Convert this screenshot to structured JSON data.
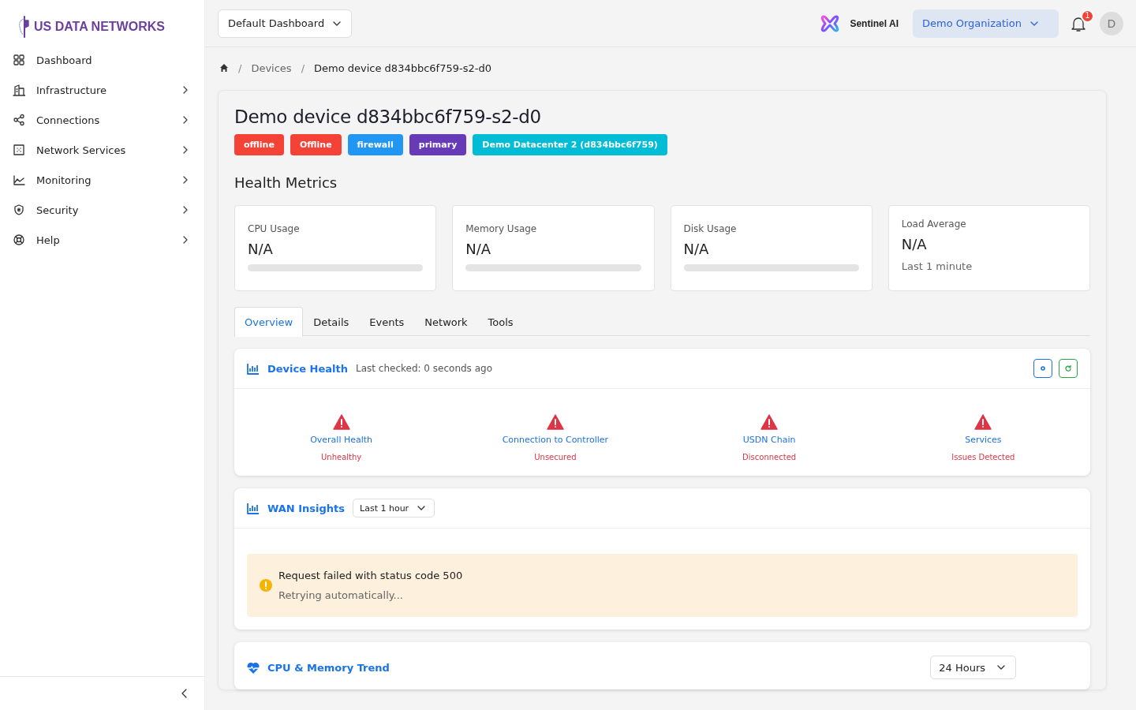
{
  "sidebar": {
    "logo": "US DATA NETWORKS",
    "items": [
      {
        "label": "Dashboard",
        "has_submenu": false
      },
      {
        "label": "Infrastructure",
        "has_submenu": true
      },
      {
        "label": "Connections",
        "has_submenu": true
      },
      {
        "label": "Network Services",
        "has_submenu": true
      },
      {
        "label": "Monitoring",
        "has_submenu": true
      },
      {
        "label": "Security",
        "has_submenu": true
      },
      {
        "label": "Help",
        "has_submenu": true
      }
    ]
  },
  "topbar": {
    "dashboard_select": "Default Dashboard",
    "assistant": "Sentinel AI",
    "organization": "Demo Organization",
    "notifications": "1",
    "avatar": "D"
  },
  "breadcrumb": [
    {
      "separator": "/",
      "label": "Devices"
    },
    {
      "separator": "/",
      "label": "Demo device d834bbc6f759-s2-d0"
    }
  ],
  "device": {
    "title": "Demo device d834bbc6f759-s2-d0",
    "badges": [
      {
        "label": "offline",
        "color": "#f44336"
      },
      {
        "label": "Offline",
        "color": "#f44336"
      },
      {
        "label": "firewall",
        "color": "#2196f3"
      },
      {
        "label": "primary",
        "color": "#673ab7"
      },
      {
        "label": "Demo Datacenter 2 (d834bbc6f759)",
        "color": "#00bcd4"
      }
    ]
  },
  "health_metrics": {
    "title": "Health Metrics",
    "cards": [
      {
        "kind": "bar",
        "label": "CPU Usage",
        "value": "N/A",
        "level": 0
      },
      {
        "kind": "bar",
        "label": "Memory Usage",
        "value": "N/A",
        "level": 0
      },
      {
        "kind": "bar",
        "label": "Disk Usage",
        "value": "N/A",
        "level": 0
      },
      {
        "kind": "text",
        "label": "Load Average",
        "value": "N/A",
        "note": "Last 1 minute"
      }
    ]
  },
  "tabs": [
    {
      "label": "Overview",
      "selected": true
    },
    {
      "label": "Details",
      "selected": false
    },
    {
      "label": "Events",
      "selected": false
    },
    {
      "label": "Network",
      "selected": false
    },
    {
      "label": "Tools",
      "selected": false
    }
  ],
  "device_health": {
    "title": "Device Health",
    "checked": "Last checked: 0 seconds ago",
    "items": [
      {
        "label": "Overall Health",
        "status": "Unhealthy"
      },
      {
        "label": "Connection to Controller",
        "status": "Unsecured"
      },
      {
        "label": "USDN Chain",
        "status": "Disconnected"
      },
      {
        "label": "Services",
        "status": "Issues Detected"
      }
    ]
  },
  "wan_insights": {
    "title": "WAN Insights",
    "range": "Last 1 hour",
    "error": "Request failed with status code 500",
    "retry": "Retrying automatically..."
  },
  "cpu_memory_trend": {
    "title": "CPU & Memory Trend",
    "range": "24 Hours"
  }
}
